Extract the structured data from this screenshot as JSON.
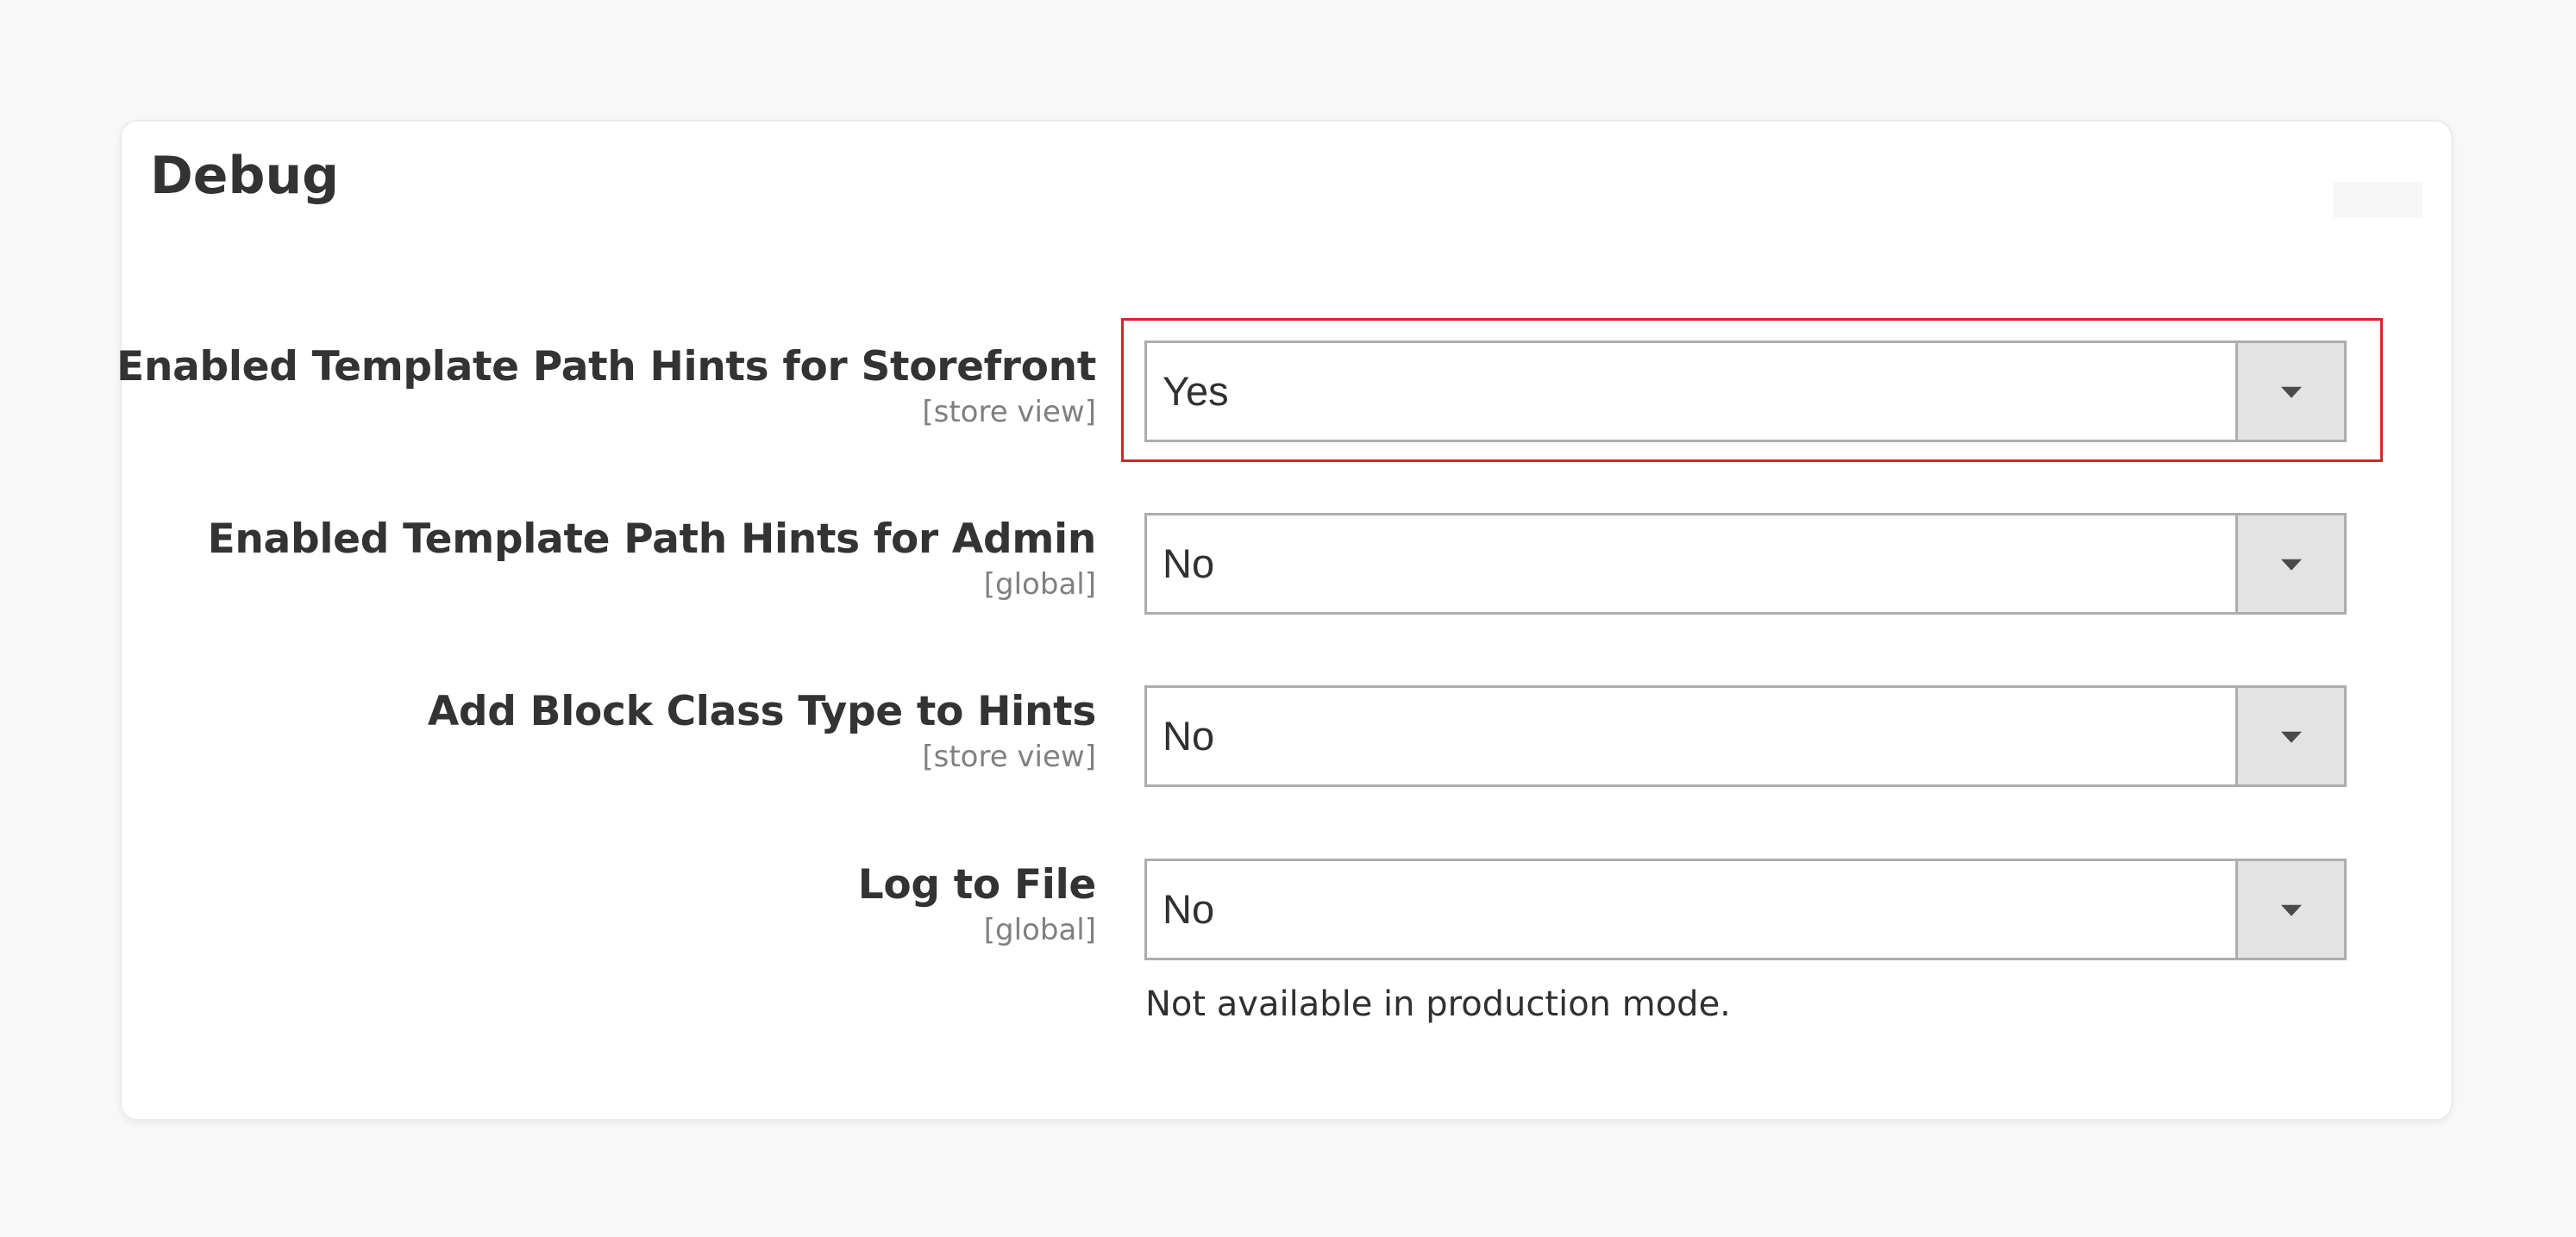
{
  "panel": {
    "title": "Debug"
  },
  "fields": [
    {
      "label": "Enabled Template Path Hints for Storefront",
      "scope": "[store view]",
      "value": "Yes",
      "highlighted": true
    },
    {
      "label": "Enabled Template Path Hints for Admin",
      "scope": "[global]",
      "value": "No"
    },
    {
      "label": "Add Block Class Type to Hints",
      "scope": "[store view]",
      "value": "No"
    },
    {
      "label": "Log to File",
      "scope": "[global]",
      "value": "No",
      "note": "Not available in production mode."
    }
  ],
  "icons": {
    "dropdown": "chevron-down-icon"
  },
  "colors": {
    "highlight": "#d6242c",
    "panel_bg": "#ffffff",
    "page_bg": "#f8f8f8",
    "select_button_bg": "#e3e3e3"
  }
}
